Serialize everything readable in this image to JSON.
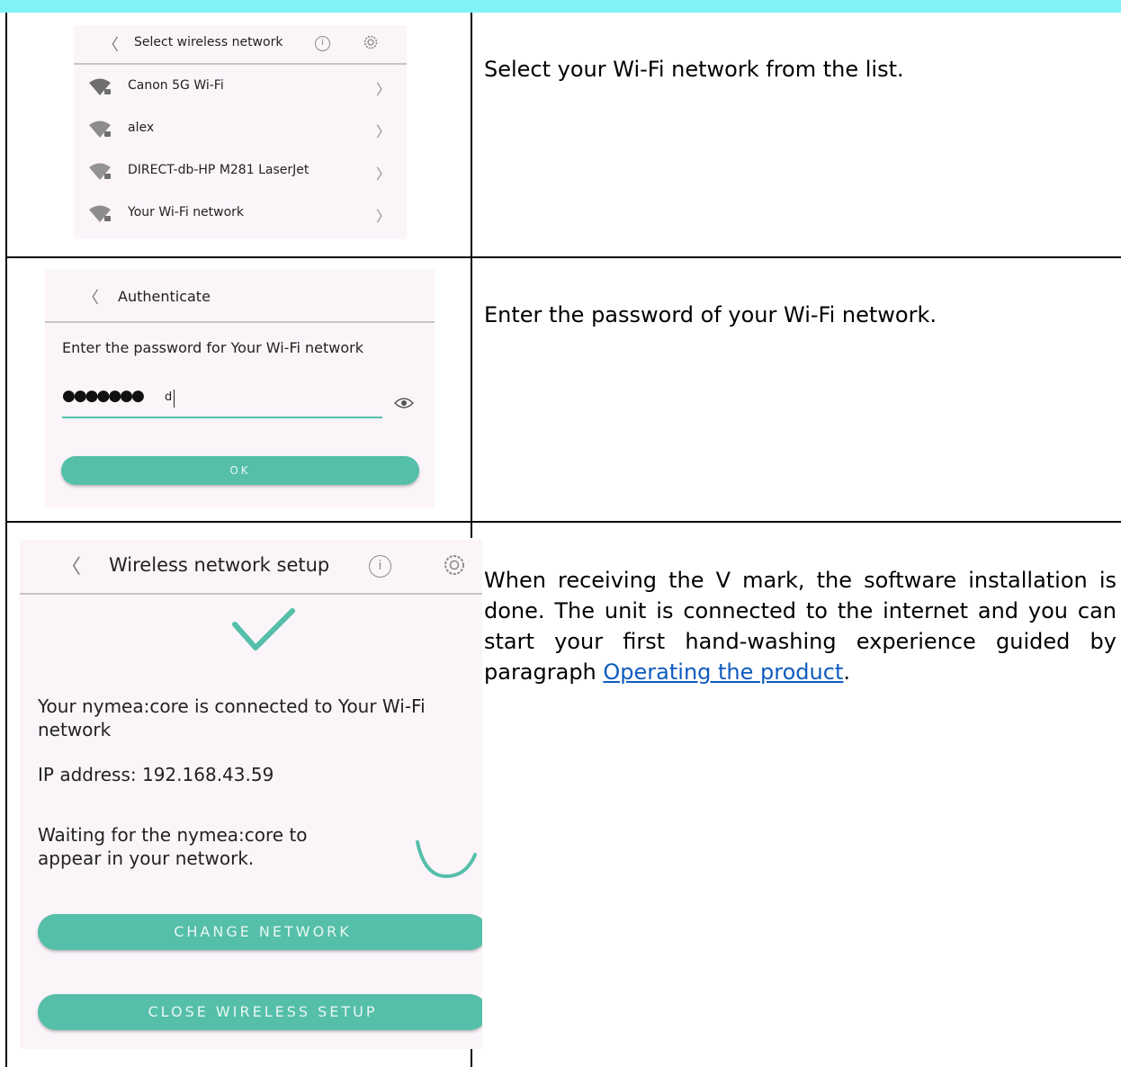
{
  "rows": [
    {
      "screen": {
        "title": "Select wireless network",
        "networks": [
          {
            "name": "Canon 5G Wi-Fi"
          },
          {
            "name": "alex"
          },
          {
            "name": "DIRECT-db-HP M281 LaserJet"
          },
          {
            "name": "Your Wi-Fi network"
          }
        ]
      },
      "description": "Select your Wi-Fi network from the list."
    },
    {
      "screen": {
        "title": "Authenticate",
        "prompt": "Enter the password for Your Wi-Fi network",
        "password_mask": "●●●●●●●",
        "password_last_char": "d",
        "ok_label": "OK"
      },
      "description": "Enter the password of your Wi-Fi network."
    },
    {
      "screen": {
        "title": "Wireless network setup",
        "connected_text": "Your nymea:core is connected to Your Wi-Fi network",
        "ip_text": "IP address: 192.168.43.59",
        "waiting_text": "Waiting for the nymea:core to appear in your network.",
        "change_network_label": "CHANGE NETWORK",
        "close_setup_label": "CLOSE WIRELESS SETUP"
      },
      "description_before_link": "When receiving the V mark, the software installation is done. The unit is connected to the internet and you can start your first hand-washing experience guided by paragraph ",
      "description_link": "Operating the product",
      "description_after_link": "."
    }
  ],
  "colors": {
    "accent_teal": "#55bfa9",
    "screen_bg": "#fbf5fa",
    "top_bar": "#7ff3f8",
    "link": "#0f5bbf"
  }
}
